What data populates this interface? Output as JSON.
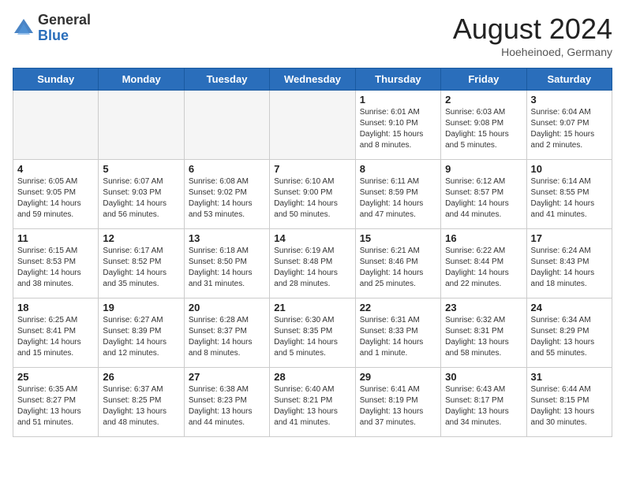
{
  "header": {
    "logo_general": "General",
    "logo_blue": "Blue",
    "month_title": "August 2024",
    "location": "Hoeheinoed, Germany"
  },
  "weekdays": [
    "Sunday",
    "Monday",
    "Tuesday",
    "Wednesday",
    "Thursday",
    "Friday",
    "Saturday"
  ],
  "weeks": [
    [
      {
        "day": "",
        "info": ""
      },
      {
        "day": "",
        "info": ""
      },
      {
        "day": "",
        "info": ""
      },
      {
        "day": "",
        "info": ""
      },
      {
        "day": "1",
        "info": "Sunrise: 6:01 AM\nSunset: 9:10 PM\nDaylight: 15 hours\nand 8 minutes."
      },
      {
        "day": "2",
        "info": "Sunrise: 6:03 AM\nSunset: 9:08 PM\nDaylight: 15 hours\nand 5 minutes."
      },
      {
        "day": "3",
        "info": "Sunrise: 6:04 AM\nSunset: 9:07 PM\nDaylight: 15 hours\nand 2 minutes."
      }
    ],
    [
      {
        "day": "4",
        "info": "Sunrise: 6:05 AM\nSunset: 9:05 PM\nDaylight: 14 hours\nand 59 minutes."
      },
      {
        "day": "5",
        "info": "Sunrise: 6:07 AM\nSunset: 9:03 PM\nDaylight: 14 hours\nand 56 minutes."
      },
      {
        "day": "6",
        "info": "Sunrise: 6:08 AM\nSunset: 9:02 PM\nDaylight: 14 hours\nand 53 minutes."
      },
      {
        "day": "7",
        "info": "Sunrise: 6:10 AM\nSunset: 9:00 PM\nDaylight: 14 hours\nand 50 minutes."
      },
      {
        "day": "8",
        "info": "Sunrise: 6:11 AM\nSunset: 8:59 PM\nDaylight: 14 hours\nand 47 minutes."
      },
      {
        "day": "9",
        "info": "Sunrise: 6:12 AM\nSunset: 8:57 PM\nDaylight: 14 hours\nand 44 minutes."
      },
      {
        "day": "10",
        "info": "Sunrise: 6:14 AM\nSunset: 8:55 PM\nDaylight: 14 hours\nand 41 minutes."
      }
    ],
    [
      {
        "day": "11",
        "info": "Sunrise: 6:15 AM\nSunset: 8:53 PM\nDaylight: 14 hours\nand 38 minutes."
      },
      {
        "day": "12",
        "info": "Sunrise: 6:17 AM\nSunset: 8:52 PM\nDaylight: 14 hours\nand 35 minutes."
      },
      {
        "day": "13",
        "info": "Sunrise: 6:18 AM\nSunset: 8:50 PM\nDaylight: 14 hours\nand 31 minutes."
      },
      {
        "day": "14",
        "info": "Sunrise: 6:19 AM\nSunset: 8:48 PM\nDaylight: 14 hours\nand 28 minutes."
      },
      {
        "day": "15",
        "info": "Sunrise: 6:21 AM\nSunset: 8:46 PM\nDaylight: 14 hours\nand 25 minutes."
      },
      {
        "day": "16",
        "info": "Sunrise: 6:22 AM\nSunset: 8:44 PM\nDaylight: 14 hours\nand 22 minutes."
      },
      {
        "day": "17",
        "info": "Sunrise: 6:24 AM\nSunset: 8:43 PM\nDaylight: 14 hours\nand 18 minutes."
      }
    ],
    [
      {
        "day": "18",
        "info": "Sunrise: 6:25 AM\nSunset: 8:41 PM\nDaylight: 14 hours\nand 15 minutes."
      },
      {
        "day": "19",
        "info": "Sunrise: 6:27 AM\nSunset: 8:39 PM\nDaylight: 14 hours\nand 12 minutes."
      },
      {
        "day": "20",
        "info": "Sunrise: 6:28 AM\nSunset: 8:37 PM\nDaylight: 14 hours\nand 8 minutes."
      },
      {
        "day": "21",
        "info": "Sunrise: 6:30 AM\nSunset: 8:35 PM\nDaylight: 14 hours\nand 5 minutes."
      },
      {
        "day": "22",
        "info": "Sunrise: 6:31 AM\nSunset: 8:33 PM\nDaylight: 14 hours\nand 1 minute."
      },
      {
        "day": "23",
        "info": "Sunrise: 6:32 AM\nSunset: 8:31 PM\nDaylight: 13 hours\nand 58 minutes."
      },
      {
        "day": "24",
        "info": "Sunrise: 6:34 AM\nSunset: 8:29 PM\nDaylight: 13 hours\nand 55 minutes."
      }
    ],
    [
      {
        "day": "25",
        "info": "Sunrise: 6:35 AM\nSunset: 8:27 PM\nDaylight: 13 hours\nand 51 minutes."
      },
      {
        "day": "26",
        "info": "Sunrise: 6:37 AM\nSunset: 8:25 PM\nDaylight: 13 hours\nand 48 minutes."
      },
      {
        "day": "27",
        "info": "Sunrise: 6:38 AM\nSunset: 8:23 PM\nDaylight: 13 hours\nand 44 minutes."
      },
      {
        "day": "28",
        "info": "Sunrise: 6:40 AM\nSunset: 8:21 PM\nDaylight: 13 hours\nand 41 minutes."
      },
      {
        "day": "29",
        "info": "Sunrise: 6:41 AM\nSunset: 8:19 PM\nDaylight: 13 hours\nand 37 minutes."
      },
      {
        "day": "30",
        "info": "Sunrise: 6:43 AM\nSunset: 8:17 PM\nDaylight: 13 hours\nand 34 minutes."
      },
      {
        "day": "31",
        "info": "Sunrise: 6:44 AM\nSunset: 8:15 PM\nDaylight: 13 hours\nand 30 minutes."
      }
    ]
  ]
}
